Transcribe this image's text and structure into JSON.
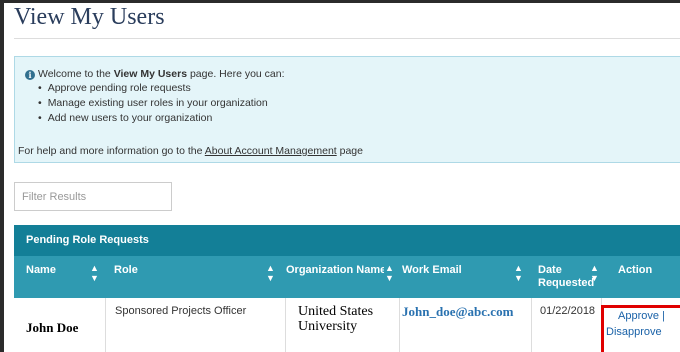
{
  "page": {
    "title": "View My Users"
  },
  "info": {
    "intro_prefix": "Welcome to the ",
    "intro_strong": "View My Users",
    "intro_suffix": " page. Here you can:",
    "bullets": [
      "Approve pending role requests",
      "Manage existing user roles in your organization",
      "Add new users to your organization"
    ],
    "help_prefix": "For help and more information go to the ",
    "help_link": "About Account Management",
    "help_suffix": " page"
  },
  "filter": {
    "placeholder": "Filter Results",
    "value": ""
  },
  "table": {
    "caption": "Pending Role Requests",
    "columns": [
      "Name",
      "Role",
      "Organization Name",
      "Work Email",
      "Date Requested",
      "Action"
    ],
    "rows": [
      {
        "name": "John Doe",
        "role": "Sponsored Projects Officer",
        "organization": "United States University",
        "email": "John_doe@abc.com",
        "date": "01/22/2018",
        "approve": "Approve |",
        "disapprove": "Disapprove"
      }
    ]
  },
  "colors": {
    "caption_bg": "#137f97",
    "header_bg": "#2f9ab1",
    "info_bg": "#e4f5f9",
    "link": "#1a62a8",
    "highlight": "#e00000"
  }
}
